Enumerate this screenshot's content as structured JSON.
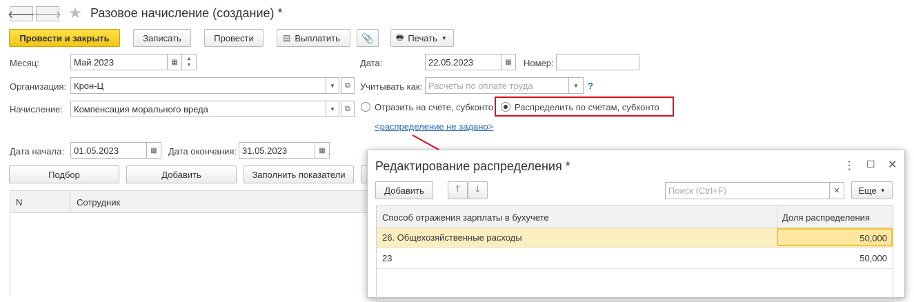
{
  "window": {
    "title": "Разовое начисление (создание) *",
    "back_icon": "arrow-left-icon",
    "forward_icon": "arrow-right-icon",
    "favorite_icon": "star-icon"
  },
  "toolbar": {
    "post_close": "Провести и закрыть",
    "save": "Записать",
    "post": "Провести",
    "pay": "Выплатить",
    "print": "Печать"
  },
  "form": {
    "month_label": "Месяц:",
    "month_value": "Май 2023",
    "date_label": "Дата:",
    "date_value": "22.05.2023",
    "number_label": "Номер:",
    "number_value": "",
    "org_label": "Организация:",
    "org_value": "Крон-Ц",
    "account_as_label": "Учитывать как:",
    "account_as_placeholder": "Расчеты по оплате труда",
    "help": "?",
    "accrual_label": "Начисление:",
    "accrual_value": "Компенсация морального вреда",
    "radio_reflect": "Отразить на счете, субконто",
    "radio_distribute": "Распределить по счетам, субконто",
    "distribution_link": "<распределение не задано>",
    "start_label": "Дата начала:",
    "start_value": "01.05.2023",
    "end_label": "Дата окончания:",
    "end_value": "31.05.2023"
  },
  "table_toolbar": {
    "pick": "Подбор",
    "add": "Добавить",
    "fill": "Заполнить показатели"
  },
  "table": {
    "columns": [
      "N",
      "Сотрудник"
    ]
  },
  "dialog": {
    "title": "Редактирование распределения *",
    "add": "Добавить",
    "search_placeholder": "Поиск (Ctrl+F)",
    "more": "Еще",
    "columns": [
      "Способ отражения зарплаты в бухучете",
      "Доля распределения"
    ],
    "rows": [
      {
        "method": "26. Общехозяйственные расходы",
        "share": "50,000"
      },
      {
        "method": "23",
        "share": "50,000"
      }
    ]
  },
  "colors": {
    "primary_button": "#f3c514",
    "highlight_box": "#e3001b",
    "selected_row": "#fbeec0",
    "link": "#2a6bb5"
  }
}
